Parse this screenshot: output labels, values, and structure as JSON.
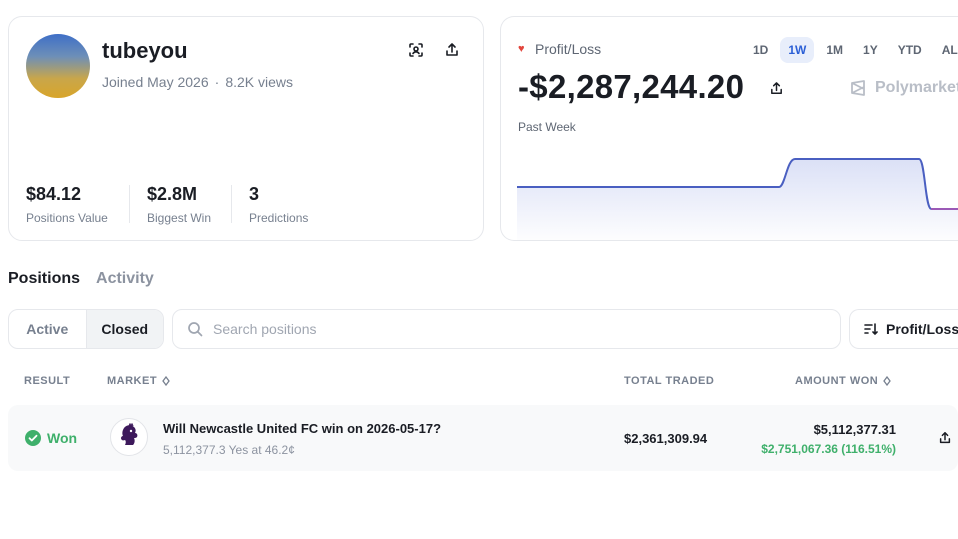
{
  "profile": {
    "username": "tubeyou",
    "joined": "Joined May 2026",
    "views": "8.2K views",
    "stats": [
      {
        "value": "$84.12",
        "label": "Positions Value"
      },
      {
        "value": "$2.8M",
        "label": "Biggest Win"
      },
      {
        "value": "3",
        "label": "Predictions"
      }
    ],
    "icons": {
      "scan": "scan-icon",
      "share": "share-icon"
    }
  },
  "pnl": {
    "label": "Profit/Loss",
    "value": "-$2,287,244.20",
    "period": "Past Week",
    "brand": "Polymarket",
    "ranges": [
      "1D",
      "1W",
      "1M",
      "1Y",
      "YTD",
      "ALL"
    ],
    "selected_range": "1W",
    "accent": "#4a5fc1",
    "loss_color": "#9b59b6"
  },
  "tabs": {
    "positions": "Positions",
    "activity": "Activity"
  },
  "filters": {
    "active": "Active",
    "closed": "Closed",
    "selected": "Closed"
  },
  "search": {
    "placeholder": "Search positions"
  },
  "sort": {
    "label": "Profit/Loss"
  },
  "table": {
    "headers": {
      "result": "RESULT",
      "market": "MARKET",
      "total_traded": "TOTAL TRADED",
      "amount_won": "AMOUNT WON"
    },
    "rows": [
      {
        "result": "Won",
        "market_title": "Will Newcastle United FC win on 2026-05-17?",
        "market_sub": "5,112,377.3 Yes at 46.2¢",
        "total_traded": "$2,361,309.94",
        "amount_won": "$5,112,377.31",
        "gain": "$2,751,067.36 (116.51%)"
      }
    ]
  },
  "colors": {
    "won": "#3fb06b",
    "active_range": "#2b5fd6",
    "heart": "#e2453c"
  }
}
